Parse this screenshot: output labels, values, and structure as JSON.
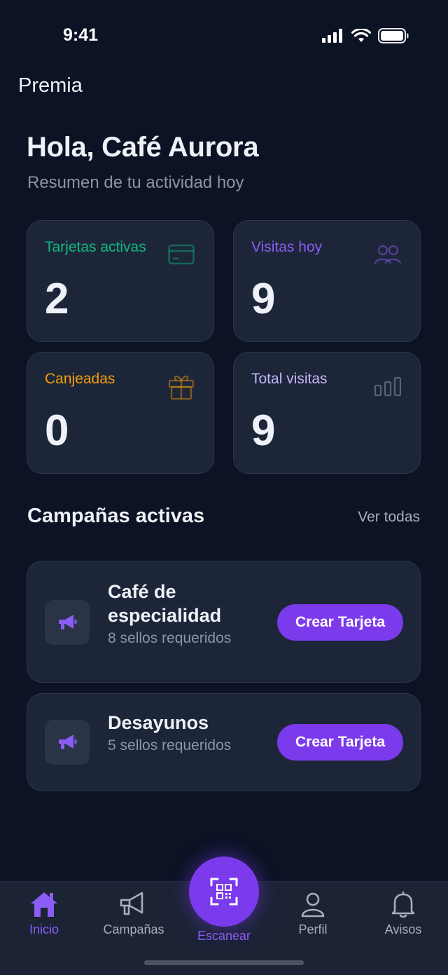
{
  "status_bar": {
    "time": "9:41"
  },
  "app": {
    "title": "Premia"
  },
  "header": {
    "greeting": "Hola, Café Aurora",
    "subtitle": "Resumen de tu actividad hoy"
  },
  "stats": [
    {
      "label": "Tarjetas activas",
      "value": "2",
      "icon": "card-icon",
      "color": "#10b981"
    },
    {
      "label": "Visitas hoy",
      "value": "9",
      "icon": "users-icon",
      "color": "#8b5cf6"
    },
    {
      "label": "Canjeadas",
      "value": "0",
      "icon": "gift-icon",
      "color": "#f59e0b"
    },
    {
      "label": "Total visitas",
      "value": "9",
      "icon": "bar-chart-icon",
      "color": "#c4b5fd"
    }
  ],
  "campaigns_section": {
    "title": "Campañas activas",
    "link": "Ver todas"
  },
  "campaigns": [
    {
      "name": "Café de especialidad",
      "meta": "8 sellos requeridos",
      "button": "Crear Tarjeta",
      "icon": "megaphone-icon"
    },
    {
      "name": "Desayunos",
      "meta": "5 sellos requeridos",
      "button": "Crear Tarjeta",
      "icon": "megaphone-icon"
    }
  ],
  "tab_bar": {
    "items": [
      {
        "label": "Inicio",
        "icon": "home-icon",
        "active": true
      },
      {
        "label": "Campañas",
        "icon": "megaphone-icon",
        "active": false
      },
      {
        "label": "Escanear",
        "icon": "qr-scan-icon",
        "active": false
      },
      {
        "label": "Perfil",
        "icon": "user-icon",
        "active": false
      },
      {
        "label": "Avisos",
        "icon": "bell-icon",
        "active": false
      }
    ]
  },
  "colors": {
    "background": "#0b1324",
    "card": "#1d2638",
    "accent": "#7c3aed"
  }
}
